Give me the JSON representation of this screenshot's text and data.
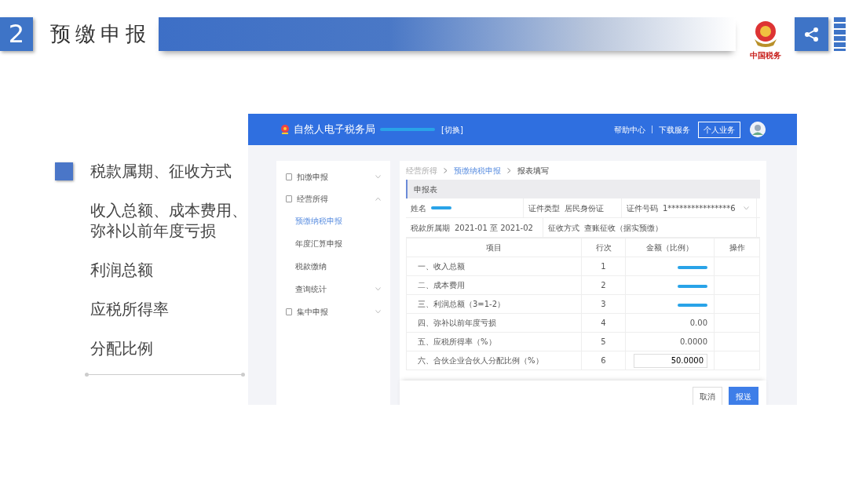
{
  "slide": {
    "number": "2",
    "title": "预缴申报",
    "logo_text": "中国税务"
  },
  "bullets": [
    {
      "text": "税款属期、征收方式",
      "marked": true
    },
    {
      "text": "收入总额、成本费用、弥补以前年度亏损",
      "marked": false
    },
    {
      "text": "利润总额",
      "marked": false
    },
    {
      "text": "应税所得率",
      "marked": false
    },
    {
      "text": "分配比例",
      "marked": false
    }
  ],
  "app": {
    "brand": "自然人电子税务局",
    "switch": "[切换]",
    "nav": [
      "帮助中心",
      "下载服务"
    ],
    "personal_button": "个人业务",
    "sidebar": [
      {
        "label": "扣缴申报",
        "expanded": false
      },
      {
        "label": "经营所得",
        "expanded": true,
        "children": [
          {
            "label": "预缴纳税申报",
            "selected": true,
            "expandable": false
          },
          {
            "label": "年度汇算申报",
            "selected": false,
            "expandable": false
          },
          {
            "label": "税款缴纳",
            "selected": false,
            "expandable": false
          },
          {
            "label": "查询统计",
            "selected": false,
            "expandable": true
          }
        ]
      },
      {
        "label": "集中申报",
        "expanded": false
      }
    ],
    "breadcrumb": [
      {
        "label": "经营所得",
        "kind": "plain"
      },
      {
        "label": "预缴纳税申报",
        "kind": "link"
      },
      {
        "label": "报表填写",
        "kind": "current"
      }
    ],
    "section_title": "申报表",
    "info_rows": [
      [
        {
          "label": "姓名",
          "redacted": true
        },
        {
          "label": "证件类型",
          "value": "居民身份证"
        },
        {
          "label": "证件号码",
          "value": "1****************6",
          "dropdown": true
        }
      ],
      [
        {
          "label": "税款所属期",
          "value": "2021-01 至 2021-02"
        },
        {
          "label": "征收方式",
          "value": "查账征收（据实预缴）"
        }
      ]
    ],
    "table": {
      "columns": [
        "项目",
        "行次",
        "金额（比例）",
        "操作"
      ],
      "rows": [
        {
          "item": "一、收入总额",
          "line": "1",
          "kind": "redacted"
        },
        {
          "item": "二、成本费用",
          "line": "2",
          "kind": "redacted"
        },
        {
          "item": "三、利润总额（3=1-2）",
          "line": "3",
          "kind": "redacted"
        },
        {
          "item": "四、弥补以前年度亏损",
          "line": "4",
          "kind": "text",
          "amount": "0.00"
        },
        {
          "item": "五、应税所得率（%）",
          "line": "5",
          "kind": "text",
          "amount": "0.0000"
        },
        {
          "item": "六、合伙企业合伙人分配比例（%）",
          "line": "6",
          "kind": "input",
          "amount": "50.0000"
        }
      ]
    },
    "buttons": [
      {
        "label": "取消",
        "primary": false
      },
      {
        "label": "报送",
        "primary": true
      }
    ]
  }
}
